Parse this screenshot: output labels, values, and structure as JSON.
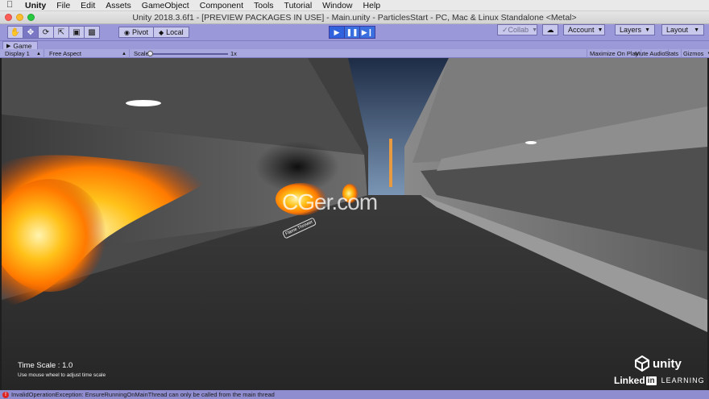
{
  "menubar": {
    "app_name": "Unity",
    "items": [
      "File",
      "Edit",
      "Assets",
      "GameObject",
      "Component",
      "Tools",
      "Tutorial",
      "Window",
      "Help"
    ]
  },
  "window": {
    "title": "Unity 2018.3.6f1 - [PREVIEW PACKAGES IN USE] - Main.unity - ParticlesStart - PC, Mac & Linux Standalone <Metal>"
  },
  "toolbar": {
    "pivot_label": "Pivot",
    "local_label": "Local",
    "collab_label": "Collab",
    "account_label": "Account",
    "layers_label": "Layers",
    "layout_label": "Layout"
  },
  "game_view": {
    "tab_label": "Game",
    "display": "Display 1",
    "aspect": "Free Aspect",
    "scale_label": "Scale",
    "scale_value": "1x",
    "maximize_label": "Maximize On Play",
    "mute_label": "Mute Audio",
    "stats_label": "Stats",
    "gizmos_label": "Gizmos"
  },
  "overlay": {
    "time_scale": "Time Scale : 1.0",
    "time_scale_hint": "Use mouse wheel to adjust time scale",
    "flame_label": "Flame Thrower",
    "watermark": "CGer.com",
    "unity_logo": "unity",
    "linkedin_word": "Linked",
    "linkedin_in": "in",
    "linkedin_learning": "LEARNING"
  },
  "status": {
    "message": "InvalidOperationException: EnsureRunningOnMainThread can only be called from the main thread"
  },
  "colors": {
    "toolbar": "#9a98d8",
    "play_active": "#2f62dc",
    "error": "#dd2222"
  }
}
